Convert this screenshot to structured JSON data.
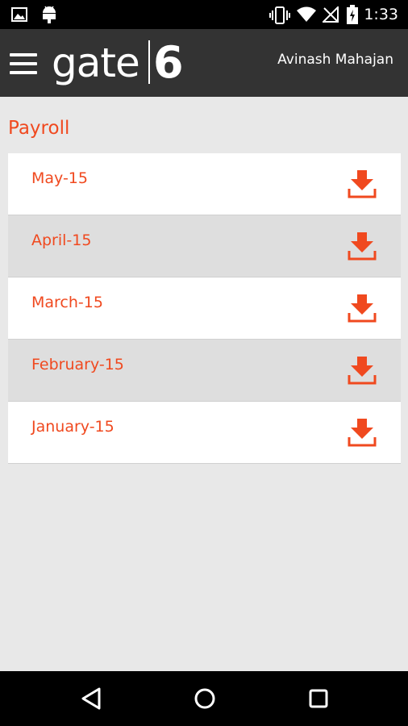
{
  "status_bar": {
    "time": "1:33",
    "left_icons": [
      "image-notification-icon",
      "android-notification-icon"
    ],
    "right_icons": [
      "vibrate-icon",
      "wifi-icon",
      "no-signal-icon",
      "battery-icon"
    ]
  },
  "header": {
    "logo_text": "gate",
    "logo_number": "6",
    "user_name": "Avinash Mahajan"
  },
  "page": {
    "title": "Payroll"
  },
  "payroll_items": [
    {
      "label": "May-15",
      "bg": "white"
    },
    {
      "label": "April-15",
      "bg": "gray"
    },
    {
      "label": "March-15",
      "bg": "white"
    },
    {
      "label": "February-15",
      "bg": "gray"
    },
    {
      "label": "January-15",
      "bg": "white"
    }
  ],
  "colors": {
    "accent": "#f0491f",
    "app_bar": "#333333",
    "background": "#e8e8e8",
    "row_alt": "#dedede"
  },
  "nav_bar": {
    "buttons": [
      "back-icon",
      "home-icon",
      "recents-icon"
    ]
  }
}
